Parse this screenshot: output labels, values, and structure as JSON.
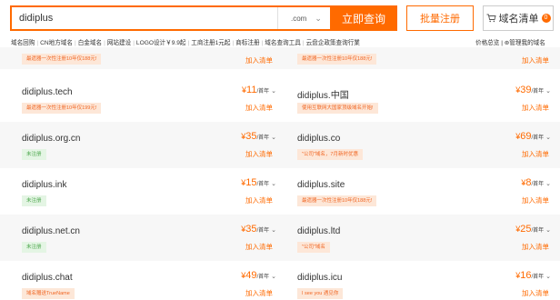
{
  "search": {
    "value": "didiplus",
    "tld": ".com",
    "button": "立即查询"
  },
  "toolbar": {
    "bulk_label": "批量注册",
    "cart_label": "域名清单",
    "cart_count": "0"
  },
  "nav": {
    "links": [
      "域名回购",
      "CN地方域名",
      "白金域名",
      "网站建设",
      "LOGO设计￥9.9起",
      "工商注册1元起",
      "商标注册",
      "域名查询工具",
      "云盘企政策查询行業"
    ],
    "right": [
      "价格总览",
      "管理我的域名"
    ]
  },
  "partial_row": {
    "left_tag": "最遗器一次性注册10年仅188元!",
    "left_add": "加入清单",
    "right_tag": "最遗器一次性注册10年仅188元!",
    "right_add": "加入清单"
  },
  "rows": [
    {
      "left": {
        "name": "didiplus.tech",
        "tag": "最遗器一次性注册10年仅199元!",
        "tag_color": "orange",
        "price": "11",
        "unit": "/首年",
        "add": "加入清单"
      },
      "right": {
        "name": "didiplus.中国",
        "tag": "使用互联网大国家顶级域名开始!",
        "tag_color": "orange",
        "price": "39",
        "unit": "/首年",
        "add": "加入清单"
      }
    },
    {
      "left": {
        "name": "didiplus.org.cn",
        "tag": "未注册",
        "tag_color": "green",
        "price": "35",
        "unit": "/首年",
        "add": "加入清单"
      },
      "right": {
        "name": "didiplus.co",
        "tag": "\"公司\"域名，7月新时优惠",
        "tag_color": "orange",
        "price": "69",
        "unit": "/首年",
        "add": "加入清单"
      }
    },
    {
      "left": {
        "name": "didiplus.ink",
        "tag": "未注册",
        "tag_color": "green",
        "price": "15",
        "unit": "/首年",
        "add": "加入清单"
      },
      "right": {
        "name": "didiplus.site",
        "tag": "最遗器一次性注册10年仅188元!",
        "tag_color": "orange",
        "price": "8",
        "unit": "/首年",
        "add": "加入清单"
      }
    },
    {
      "left": {
        "name": "didiplus.net.cn",
        "tag": "未注册",
        "tag_color": "green",
        "price": "35",
        "unit": "/首年",
        "add": "加入清单"
      },
      "right": {
        "name": "didiplus.ltd",
        "tag": "\"公司\"域名",
        "tag_color": "orange",
        "price": "25",
        "unit": "/首年",
        "add": "加入清单"
      }
    },
    {
      "left": {
        "name": "didiplus.chat",
        "tag": "域名赠送TrueName",
        "tag_color": "orange",
        "price": "49",
        "unit": "/首年",
        "add": "加入清单"
      },
      "right": {
        "name": "didiplus.icu",
        "tag": "I see you 遇见你",
        "tag_color": "orange",
        "price": "16",
        "unit": "/首年",
        "add": "加入清单"
      }
    }
  ],
  "colors": {
    "accent": "#ff6a00",
    "row_shade": "#f7f7f7",
    "tag_orange_bg": "#fde7d8",
    "tag_green_bg": "#e4f5e4"
  }
}
